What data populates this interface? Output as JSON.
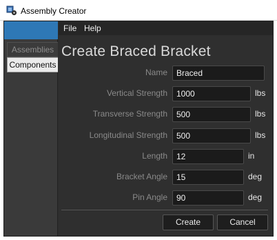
{
  "window": {
    "title": "Assembly Creator"
  },
  "sidebar": {
    "tabs": [
      {
        "label": "Assemblies",
        "selected": false
      },
      {
        "label": "Components",
        "selected": true
      }
    ]
  },
  "menu": {
    "items": [
      "File",
      "Help"
    ]
  },
  "form": {
    "title": "Create Braced Bracket",
    "fields": [
      {
        "label": "Name",
        "value": "Braced",
        "unit": ""
      },
      {
        "label": "Vertical Strength",
        "value": "1000",
        "unit": "lbs"
      },
      {
        "label": "Transverse Strength",
        "value": "500",
        "unit": "lbs"
      },
      {
        "label": "Longitudinal Strength",
        "value": "500",
        "unit": "lbs"
      },
      {
        "label": "Length",
        "value": "12",
        "unit": "in"
      },
      {
        "label": "Bracket Angle",
        "value": "15",
        "unit": "deg"
      },
      {
        "label": "Pin Angle",
        "value": "90",
        "unit": "deg"
      }
    ]
  },
  "buttons": {
    "create": "Create",
    "cancel": "Cancel"
  },
  "colors": {
    "accent": "#2e78b6",
    "background": "#2f2f2f",
    "label": "#8a8a8a"
  }
}
